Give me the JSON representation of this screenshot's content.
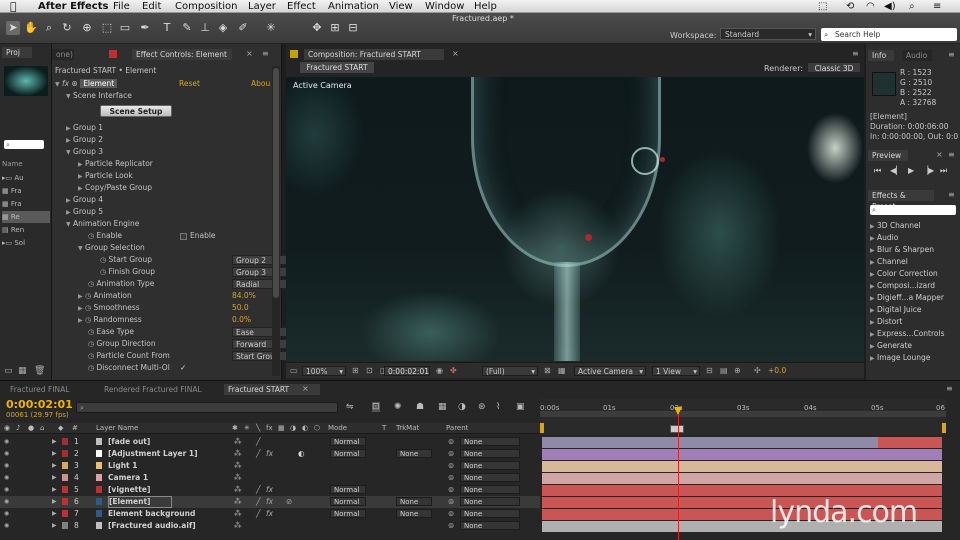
{
  "menubar": {
    "apple": "",
    "app_name": "After Effects",
    "items": [
      "File",
      "Edit",
      "Composition",
      "Layer",
      "Effect",
      "Animation",
      "View",
      "Window",
      "Help"
    ],
    "document_title": "Fractured.aep *"
  },
  "toolbar": {
    "workspace_label": "Workspace:",
    "workspace_value": "Standard",
    "search_help_placeholder": "Search Help"
  },
  "project_panel": {
    "tab": "Proj",
    "rows": [
      "Au",
      "Fra",
      "Fra",
      "Re",
      "Ren",
      "Sol"
    ],
    "col_header": "Name"
  },
  "effect_controls": {
    "tab_dim": "one)",
    "tab": "Effect Controls: Element",
    "breadcrumb": "Fractured START • Element",
    "effect_name": "Element",
    "reset": "Reset",
    "about": "Abou",
    "scene_interface": "Scene Interface",
    "scene_setup_button": "Scene Setup",
    "groups": [
      "Group 1",
      "Group 2",
      "Group 3",
      "Group 4",
      "Group 5"
    ],
    "group3_children": [
      "Particle Replicator",
      "Particle Look",
      "Copy/Paste Group"
    ],
    "animation_engine": "Animation Engine",
    "enable_label": "Enable",
    "enable_value": "Enable",
    "group_selection": "Group Selection",
    "start_group_label": "Start Group",
    "start_group_value": "Group 2",
    "finish_group_label": "Finish Group",
    "finish_group_value": "Group 3",
    "animation_type_label": "Animation Type",
    "animation_type_value": "Radial",
    "animation_label": "Animation",
    "animation_value": "84.0%",
    "smoothness_label": "Smoothness",
    "smoothness_value": "50.0",
    "randomness_label": "Randomness",
    "randomness_value": "0.0%",
    "ease_type_label": "Ease Type",
    "ease_type_value": "Ease",
    "group_direction_label": "Group Direction",
    "group_direction_value": "Forward",
    "particle_count_label": "Particle Count From",
    "particle_count_value": "Start Group",
    "disconnect_label": "Disconnect Multi-Ol",
    "disconnect_check": "✓"
  },
  "composition": {
    "tab": "Composition: Fractured START",
    "comp_button": "Fractured START",
    "renderer_label": "Renderer:",
    "renderer_value": "Classic 3D",
    "active_camera_overlay": "Active Camera",
    "zoom": "100%",
    "timecode": "0:00:02:01",
    "resolution": "(Full)",
    "camera_view": "Active Camera",
    "view_count": "1 View",
    "exposure": "+0.0"
  },
  "info_panel": {
    "tab": "Info",
    "tab2": "Audio",
    "r": "R : 1523",
    "g": "G : 2510",
    "b": "B : 2522",
    "a": "A : 32768",
    "layer": "[Element]",
    "duration": "Duration: 0:00:06:00",
    "in_out": "In: 0:00:00:00, Out: 0:0"
  },
  "preview_panel": {
    "tab": "Preview"
  },
  "effects_presets": {
    "tab": "Effects & Preset",
    "items": [
      "3D Channel",
      "Audio",
      "Blur & Sharpen",
      "Channel",
      "Color Correction",
      "Composi...izard",
      "Digieff...a Mapper",
      "Digital Juice",
      "Distort",
      "Express...Controls",
      "Generate",
      "Image Lounge"
    ]
  },
  "timeline": {
    "tabs": [
      "Fractured FINAL",
      "Rendered Fractured FINAL",
      "Fractured START"
    ],
    "timecode": "0:00:02:01",
    "frames": "00061 (29.97 fps)",
    "columns": {
      "layer_name": "Layer Name",
      "mode": "Mode",
      "t": "T",
      "trkmat": "TrkMat",
      "parent": "Parent"
    },
    "ruler": [
      "0:00s",
      "01s",
      "02s",
      "03s",
      "04s",
      "05s",
      "06"
    ],
    "layers": [
      {
        "num": "1",
        "name": "[fade out]",
        "mode": "Normal",
        "trkmat": "",
        "parent": "None",
        "color": "#c0c0c0",
        "label": "#a03030",
        "bar_color": "#c95555",
        "bar_from": 0.84,
        "bar_to": 1.0
      },
      {
        "num": "2",
        "name": "[Adjustment Layer 1]",
        "mode": "Normal",
        "trkmat": "None",
        "parent": "None",
        "color": "#ffffff",
        "label": "#a03030",
        "bar_color": "#a07fb6",
        "bar_from": 0,
        "bar_to": 1.0
      },
      {
        "num": "3",
        "name": "Light 1",
        "mode": "",
        "trkmat": "",
        "parent": "None",
        "color": "#e8c070",
        "label": "#d8a860",
        "bar_color": "#d8b79a",
        "bar_from": 0,
        "bar_to": 1.0
      },
      {
        "num": "4",
        "name": "Camera 1",
        "mode": "",
        "trkmat": "",
        "parent": "None",
        "color": "#e0a0a0",
        "label": "#d09090",
        "bar_color": "#d0a6a4",
        "bar_from": 0,
        "bar_to": 1.0
      },
      {
        "num": "5",
        "name": "[vignette]",
        "mode": "Normal",
        "trkmat": "",
        "parent": "None",
        "color": "#c03030",
        "label": "#c03030",
        "bar_color": "#c95555",
        "bar_from": 0,
        "bar_to": 1.0
      },
      {
        "num": "6",
        "name": "[Element]",
        "mode": "Normal",
        "trkmat": "None",
        "parent": "None",
        "color": "#2b5c8a",
        "label": "#c03030",
        "bar_color": "#c95555",
        "bar_from": 0,
        "bar_to": 1.0
      },
      {
        "num": "7",
        "name": "Element background",
        "mode": "Normal",
        "trkmat": "None",
        "parent": "None",
        "color": "#2b5c8a",
        "label": "#c03030",
        "bar_color": "#c95555",
        "bar_from": 0,
        "bar_to": 1.0
      },
      {
        "num": "8",
        "name": "[Fractured audio.aif]",
        "mode": "",
        "trkmat": "",
        "parent": "None",
        "color": "#c0c0c0",
        "label": "#808080",
        "bar_color": "#b0b0b0",
        "bar_from": 0,
        "bar_to": 1.0
      }
    ],
    "playhead_fraction": 0.341
  },
  "watermark": "lynda.com",
  "colors": {
    "accent_timecode": "#f0b400",
    "value_orange": "#d9a520",
    "playhead": "#d8262b"
  }
}
